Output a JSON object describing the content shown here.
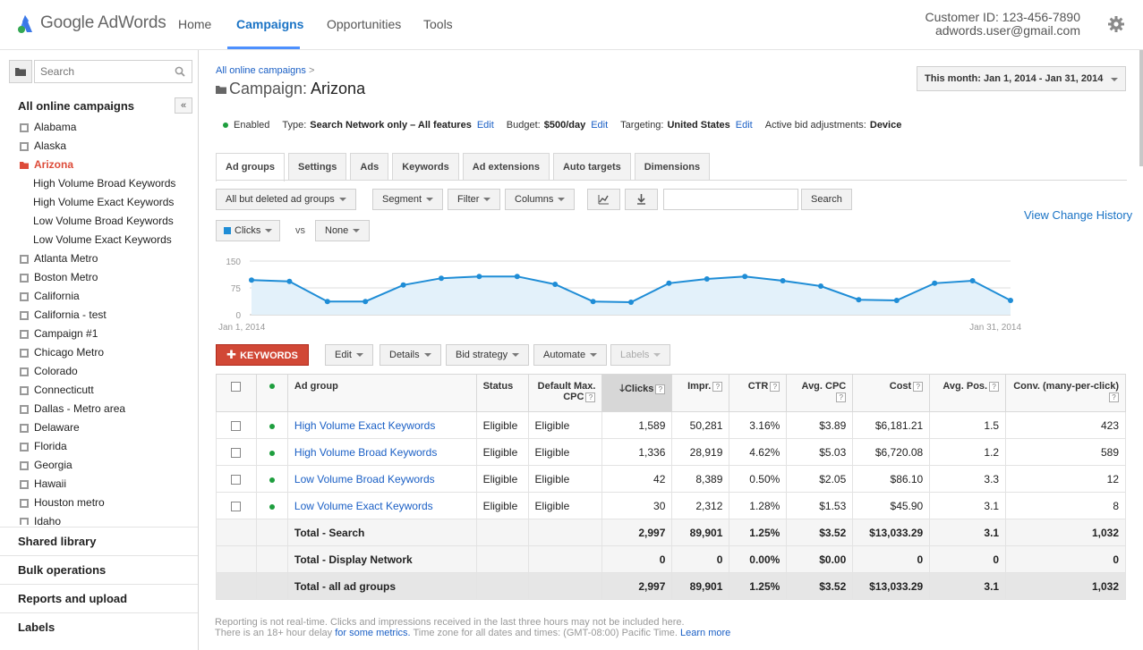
{
  "app": {
    "logo_text": "Google AdWords",
    "nav": [
      "Home",
      "Campaigns",
      "Opportunities",
      "Tools"
    ],
    "active_nav": "Campaigns",
    "customer_id": "Customer ID: 123-456-7890",
    "user_email": "adwords.user@gmail.com"
  },
  "sidebar": {
    "search_placeholder": "Search",
    "tree_title": "All online campaigns",
    "collapse_label": "«",
    "items": [
      {
        "label": "Alabama",
        "type": "campaign"
      },
      {
        "label": "Alaska",
        "type": "campaign"
      },
      {
        "label": "Arizona",
        "type": "campaign-open"
      },
      {
        "label": "High Volume Broad Keywords",
        "type": "adgroup"
      },
      {
        "label": "High Volume Exact Keywords",
        "type": "adgroup"
      },
      {
        "label": "Low Volume Broad Keywords",
        "type": "adgroup"
      },
      {
        "label": "Low Volume Exact Keywords",
        "type": "adgroup"
      },
      {
        "label": "Atlanta Metro",
        "type": "campaign"
      },
      {
        "label": "Boston Metro",
        "type": "campaign"
      },
      {
        "label": "California",
        "type": "campaign"
      },
      {
        "label": "California - test",
        "type": "campaign"
      },
      {
        "label": "Campaign #1",
        "type": "campaign"
      },
      {
        "label": "Chicago Metro",
        "type": "campaign"
      },
      {
        "label": "Colorado",
        "type": "campaign"
      },
      {
        "label": "Connecticutt",
        "type": "campaign"
      },
      {
        "label": "Dallas - Metro area",
        "type": "campaign"
      },
      {
        "label": "Delaware",
        "type": "campaign"
      },
      {
        "label": "Florida",
        "type": "campaign"
      },
      {
        "label": "Georgia",
        "type": "campaign"
      },
      {
        "label": "Hawaii",
        "type": "campaign"
      },
      {
        "label": "Houston metro",
        "type": "campaign"
      },
      {
        "label": "Idaho",
        "type": "campaign"
      }
    ],
    "sections": [
      "Shared library",
      "Bulk operations",
      "Reports and upload",
      "Labels"
    ]
  },
  "main": {
    "breadcrumb": "All online campaigns",
    "breadcrumb_sep": ">",
    "title_prefix": "Campaign:",
    "title_name": "Arizona",
    "date_range": "This month: Jan 1, 2014 - Jan 31, 2014",
    "status": {
      "state": "Enabled",
      "type_label": "Type:",
      "type_value": "Search Network only – All features",
      "budget_label": "Budget:",
      "budget_value": "$500/day",
      "targeting_label": "Targeting:",
      "targeting_value": "United States",
      "bid_label": "Active bid adjustments:",
      "bid_value": "Device",
      "edit": "Edit"
    },
    "tabs": [
      "Ad groups",
      "Settings",
      "Ads",
      "Keywords",
      "Ad extensions",
      "Auto targets",
      "Dimensions"
    ],
    "toolbar": {
      "filter_select": "All but deleted ad groups",
      "segment": "Segment",
      "filter": "Filter",
      "columns": "Columns",
      "search_button": "Search",
      "view_history": "View Change History",
      "metric1": "Clicks",
      "vs": "vs",
      "metric2": "None"
    },
    "action_bar": {
      "keywords": "KEYWORDS",
      "edit": "Edit",
      "details": "Details",
      "bid_strategy": "Bid strategy",
      "automate": "Automate",
      "labels": "Labels"
    },
    "table": {
      "headers": [
        "Ad group",
        "Status",
        "Default Max. CPC",
        "Clicks",
        "Impr.",
        "CTR",
        "Avg. CPC",
        "Cost",
        "Avg. Pos.",
        "Conv. (many-per-click)"
      ],
      "default_cpc_h1": "Default Max.",
      "default_cpc_h2": "CPC",
      "help": "?",
      "rows": [
        {
          "name": "High Volume Exact Keywords",
          "status": "Eligible",
          "cpc": "Eligible",
          "clicks": "1,589",
          "impr": "50,281",
          "ctr": "3.16%",
          "avg_cpc": "$3.89",
          "cost": "$6,181.21",
          "pos": "1.5",
          "conv": "423"
        },
        {
          "name": "High Volume Broad Keywords",
          "status": "Eligible",
          "cpc": "Eligible",
          "clicks": "1,336",
          "impr": "28,919",
          "ctr": "4.62%",
          "avg_cpc": "$5.03",
          "cost": "$6,720.08",
          "pos": "1.2",
          "conv": "589"
        },
        {
          "name": "Low Volume Broad Keywords",
          "status": "Eligible",
          "cpc": "Eligible",
          "clicks": "42",
          "impr": "8,389",
          "ctr": "0.50%",
          "avg_cpc": "$2.05",
          "cost": "$86.10",
          "pos": "3.3",
          "conv": "12"
        },
        {
          "name": "Low Volume Exact Keywords",
          "status": "Eligible",
          "cpc": "Eligible",
          "clicks": "30",
          "impr": "2,312",
          "ctr": "1.28%",
          "avg_cpc": "$1.53",
          "cost": "$45.90",
          "pos": "3.1",
          "conv": "8"
        }
      ],
      "totals": [
        {
          "name": "Total - Search",
          "clicks": "2,997",
          "impr": "89,901",
          "ctr": "1.25%",
          "avg_cpc": "$3.52",
          "cost": "$13,033.29",
          "pos": "3.1",
          "conv": "1,032"
        },
        {
          "name": "Total - Display Network",
          "clicks": "0",
          "impr": "0",
          "ctr": "0.00%",
          "avg_cpc": "$0.00",
          "cost": "0",
          "pos": "0",
          "conv": "0"
        },
        {
          "name": "Total - all ad groups",
          "clicks": "2,997",
          "impr": "89,901",
          "ctr": "1.25%",
          "avg_cpc": "$3.52",
          "cost": "$13,033.29",
          "pos": "3.1",
          "conv": "1,032"
        }
      ]
    },
    "footnote": {
      "line1": "Reporting is not real-time. Clicks and impressions received in the last three hours may not be included here.",
      "line2_a": "There is an 18+ hour delay",
      "line2_link": "for some metrics.",
      "line2_b": "Time zone for all dates and times: (GMT-08:00) Pacific Time.",
      "learn_more": "Learn more"
    }
  },
  "chart_data": {
    "type": "area",
    "x_start_label": "Jan 1, 2014",
    "x_end_label": "Jan 31, 2014",
    "y_ticks": [
      0,
      75,
      150
    ],
    "ylim": [
      0,
      150
    ],
    "series": [
      {
        "name": "Clicks",
        "color": "#1f8dd6",
        "values": [
          97,
          93,
          37,
          37,
          83,
          102,
          107,
          107,
          85,
          37,
          35,
          88,
          100,
          107,
          95,
          80,
          42,
          40,
          88,
          95,
          40
        ]
      }
    ],
    "grid": true
  },
  "colors": {
    "accent": "#1a73c5",
    "red": "#d14836",
    "enabled": "#1e9e3e",
    "line": "#1f8dd6"
  }
}
